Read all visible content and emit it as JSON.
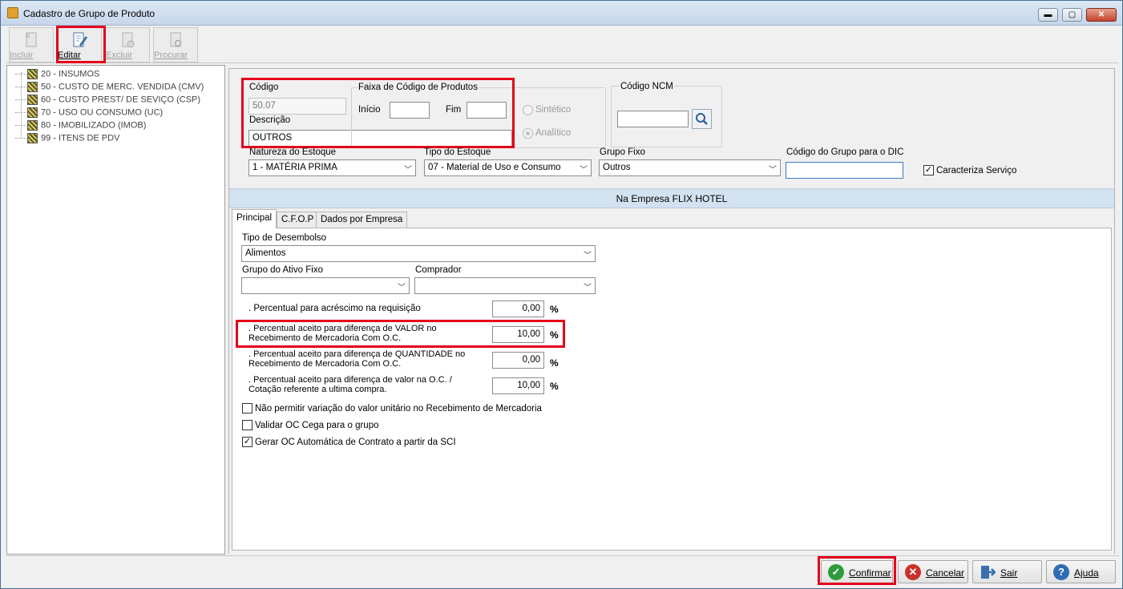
{
  "window": {
    "title": "Cadastro de Grupo de Produto",
    "minimize": "▬",
    "maximize": "▢",
    "close": "✕"
  },
  "toolbar": {
    "incluir": "Incluir",
    "editar": "Editar",
    "excluir": "Excluir",
    "procurar": "Procurar"
  },
  "tree": {
    "items": [
      "20 - INSUMOS",
      "50 - CUSTO DE MERC. VENDIDA (CMV)",
      "60 - CUSTO PREST/ DE SEVIÇO (CSP)",
      "70 - USO OU CONSUMO (UC)",
      "80 - IMOBILIZADO (IMOB)",
      "99 - ITENS DE PDV"
    ]
  },
  "form": {
    "codigo_label": "Código",
    "codigo_value": "50.07",
    "descricao_label": "Descrição",
    "descricao_value": "OUTROS",
    "faixa_label": "Faixa de Código de Produtos",
    "inicio_label": "Início",
    "inicio_value": "",
    "fim_label": "Fim",
    "fim_value": "",
    "sintetico_label": "Sintético",
    "analitico_label": "Analítico",
    "ncm_label": "Código NCM",
    "ncm_value": "",
    "natureza_label": "Natureza do Estoque",
    "natureza_value": "1 - MATÉRIA PRIMA",
    "tipo_estoque_label": "Tipo do Estoque",
    "tipo_estoque_value": "07 - Material de Uso e Consumo",
    "grupo_fixo_label": "Grupo Fixo",
    "grupo_fixo_value": "Outros",
    "dic_label": "Código do Grupo para o DIC",
    "dic_value": "",
    "caracteriza_label": "Caracteriza Serviço",
    "caracteriza_checked": true
  },
  "banner": "Na Empresa FLIX HOTEL",
  "tabs": [
    "Principal",
    "C.F.O.P",
    "Dados por Empresa"
  ],
  "principal": {
    "tipo_desembolso_label": "Tipo de Desembolso",
    "tipo_desembolso_value": "Alimentos",
    "grupo_ativo_label": "Grupo do Ativo Fixo",
    "grupo_ativo_value": "",
    "comprador_label": "Comprador",
    "comprador_value": "",
    "perc1_label": ". Percentual para acréscimo na requisição",
    "perc1_value": "0,00",
    "perc2_label_1": ". Percentual aceito para diferença de VALOR no",
    "perc2_label_2": "Recebimento de Mercadoria Com O.C.",
    "perc2_value": "10,00",
    "perc3_label_1": ". Percentual aceito para diferença de QUANTIDADE no",
    "perc3_label_2": "Recebimento de Mercadoria Com O.C.",
    "perc3_value": "0,00",
    "perc4_label_1": ". Percentual aceito para diferença de valor na O.C. /",
    "perc4_label_2": "Cotação referente a ultima compra.",
    "perc4_value": "10,00",
    "pct_symbol": "%",
    "cb1_label": "Não permitir variação do valor unitário no Recebimento de Mercadoria",
    "cb2_label": "Validar OC Cega para o grupo",
    "cb3_label": "Gerar OC Automática de Contrato a partir da SCI",
    "cb1_checked": false,
    "cb2_checked": false,
    "cb3_checked": true
  },
  "buttons": {
    "confirmar": "Confirmar",
    "cancelar": "Cancelar",
    "sair": "Sair",
    "ajuda": "Ajuda"
  },
  "colors": {
    "highlight": "#e3001b",
    "confirm_green": "#2e9b3c",
    "cancel_red": "#c9322a",
    "help_blue": "#2f6db5"
  }
}
